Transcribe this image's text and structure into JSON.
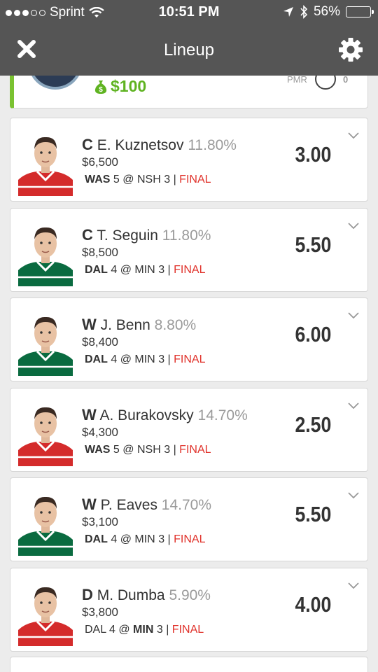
{
  "status_bar": {
    "carrier": "Sprint",
    "time": "10:51 PM",
    "battery": "56%"
  },
  "nav": {
    "title": "Lineup",
    "close_icon": "close-icon",
    "settings_icon": "gear-icon"
  },
  "top_card": {
    "money": "$100",
    "pmr_label": "PMR",
    "pmr_value": "0"
  },
  "colors": {
    "header_bg": "#555555",
    "accent_green": "#7ac231",
    "final_red": "#e0322b",
    "pct_gray": "#9a9a9a"
  },
  "players": [
    {
      "pos": "C",
      "name": "E. Kuznetsov",
      "pct": "11.80%",
      "salary": "$6,500",
      "team": "WAS",
      "team_score": "5",
      "at": "@",
      "opp": "NSH",
      "opp_score": "3",
      "sep": "|",
      "status": "FINAL",
      "points": "3.00",
      "jersey": "red"
    },
    {
      "pos": "C",
      "name": "T. Seguin",
      "pct": "11.80%",
      "salary": "$8,500",
      "team": "DAL",
      "team_score": "4",
      "at": "@",
      "opp": "MIN",
      "opp_score": "3",
      "sep": "|",
      "status": "FINAL",
      "points": "5.50",
      "jersey": "green"
    },
    {
      "pos": "W",
      "name": "J. Benn",
      "pct": "8.80%",
      "salary": "$8,400",
      "team": "DAL",
      "team_score": "4",
      "at": "@",
      "opp": "MIN",
      "opp_score": "3",
      "sep": "|",
      "status": "FINAL",
      "points": "6.00",
      "jersey": "green"
    },
    {
      "pos": "W",
      "name": "A. Burakovsky",
      "pct": "14.70%",
      "salary": "$4,300",
      "team": "WAS",
      "team_score": "5",
      "at": "@",
      "opp": "NSH",
      "opp_score": "3",
      "sep": "|",
      "status": "FINAL",
      "points": "2.50",
      "jersey": "red"
    },
    {
      "pos": "W",
      "name": "P. Eaves",
      "pct": "14.70%",
      "salary": "$3,100",
      "team": "DAL",
      "team_score": "4",
      "at": "@",
      "opp": "MIN",
      "opp_score": "3",
      "sep": "|",
      "status": "FINAL",
      "points": "5.50",
      "jersey": "green"
    },
    {
      "pos": "D",
      "name": "M. Dumba",
      "pct": "5.90%",
      "salary": "$3,800",
      "team": "DAL",
      "team_score": "4",
      "at": "@",
      "opp": "MIN",
      "opp_score": "3",
      "sep": "|",
      "status": "FINAL",
      "points": "4.00",
      "jersey": "red"
    }
  ]
}
